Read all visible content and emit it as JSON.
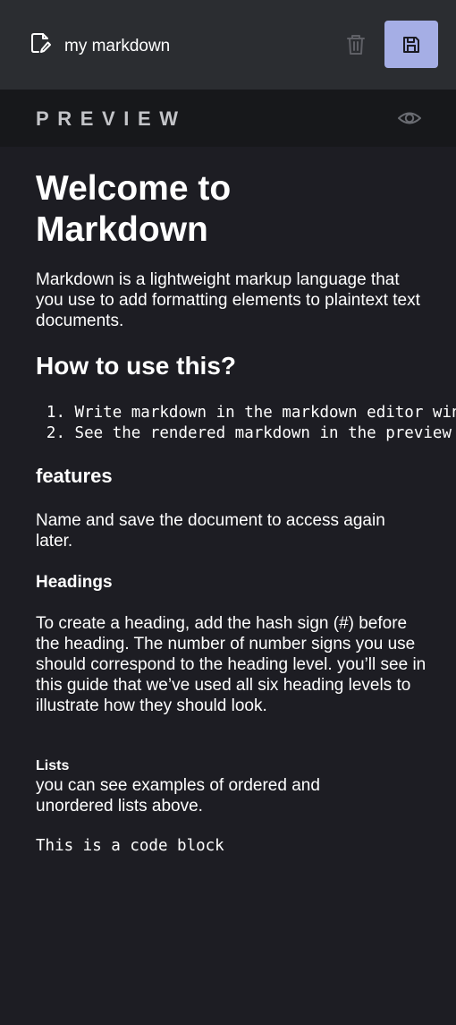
{
  "header": {
    "document_name": "my markdown",
    "icons": {
      "document": "document-edit-icon",
      "delete": "trash-icon",
      "save": "floppy-disk-icon"
    },
    "colors": {
      "background": "#2b2d31",
      "save_button": "#a5aee5",
      "delete_icon": "#5f6066"
    }
  },
  "preview": {
    "label": "PREVIEW",
    "toggle_icon": "eye-icon",
    "colors": {
      "background": "#17181b",
      "label": "#c3c4c8"
    }
  },
  "content": {
    "h1": "Welcome to Markdown",
    "intro": "Markdown is a lightweight markup language that you use to add formatting elements to plaintext text documents.",
    "h2": "How to use this?",
    "ordered_list": [
      {
        "number": "1.",
        "text": "Write markdown in the markdown editor window"
      },
      {
        "number": "2.",
        "text": "See the rendered markdown in the preview window"
      }
    ],
    "h3": "features",
    "unordered_list": [
      "Name and save the document to access again later."
    ],
    "h4": "Headings",
    "headings_paragraph": "To create a heading, add the hash sign (#) before the heading. The number of number signs you use should correspond to the heading level. you’ll see in this guide that we’ve used all six heading levels to illustrate how they should look.",
    "h5": "Lists",
    "lists_paragraph": "you can see examples of ordered and unordered lists above.",
    "code_block": "This is a code block",
    "colors": {
      "background": "#1d1d23",
      "text": "#ffffff"
    }
  }
}
